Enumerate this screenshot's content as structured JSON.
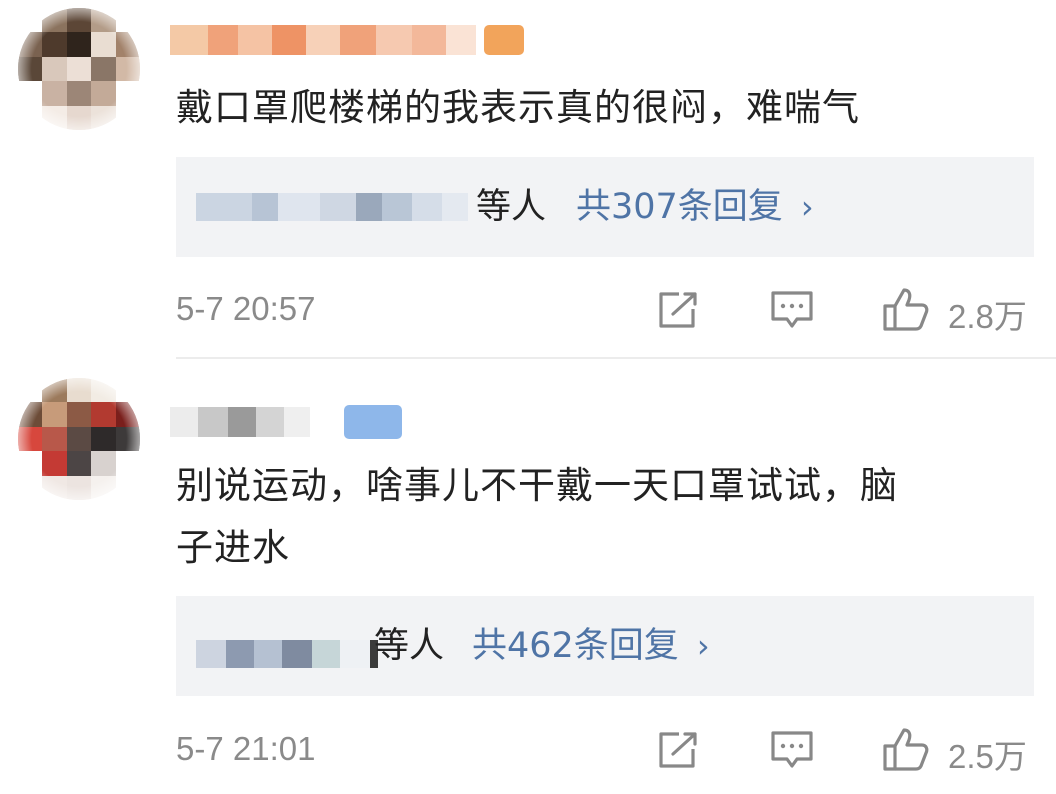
{
  "comments": [
    {
      "content": "戴口罩爬楼梯的我表示真的很闷，难喘气",
      "replies": {
        "etc_label": "等人",
        "count_label": "共307条回复",
        "chevron": "›"
      },
      "time": "5-7 20:57",
      "actions": {
        "share_icon": "share-icon",
        "comment_icon": "comment-icon",
        "like_icon": "thumbs-up-icon",
        "like_count": "2.8万"
      }
    },
    {
      "content_lines": [
        "别说运动，啥事儿不干戴一天口罩试试，脑",
        "子进水"
      ],
      "replies": {
        "etc_label": "等人",
        "count_label": "共462条回复",
        "chevron": "›"
      },
      "time": "5-7 21:01",
      "actions": {
        "share_icon": "share-icon",
        "comment_icon": "comment-icon",
        "like_icon": "thumbs-up-icon",
        "like_count": "2.5万"
      }
    }
  ],
  "colors": {
    "link": "#4f74a6",
    "meta": "#8a8a8a",
    "reply_bg": "#f2f3f5",
    "text": "#222222"
  }
}
